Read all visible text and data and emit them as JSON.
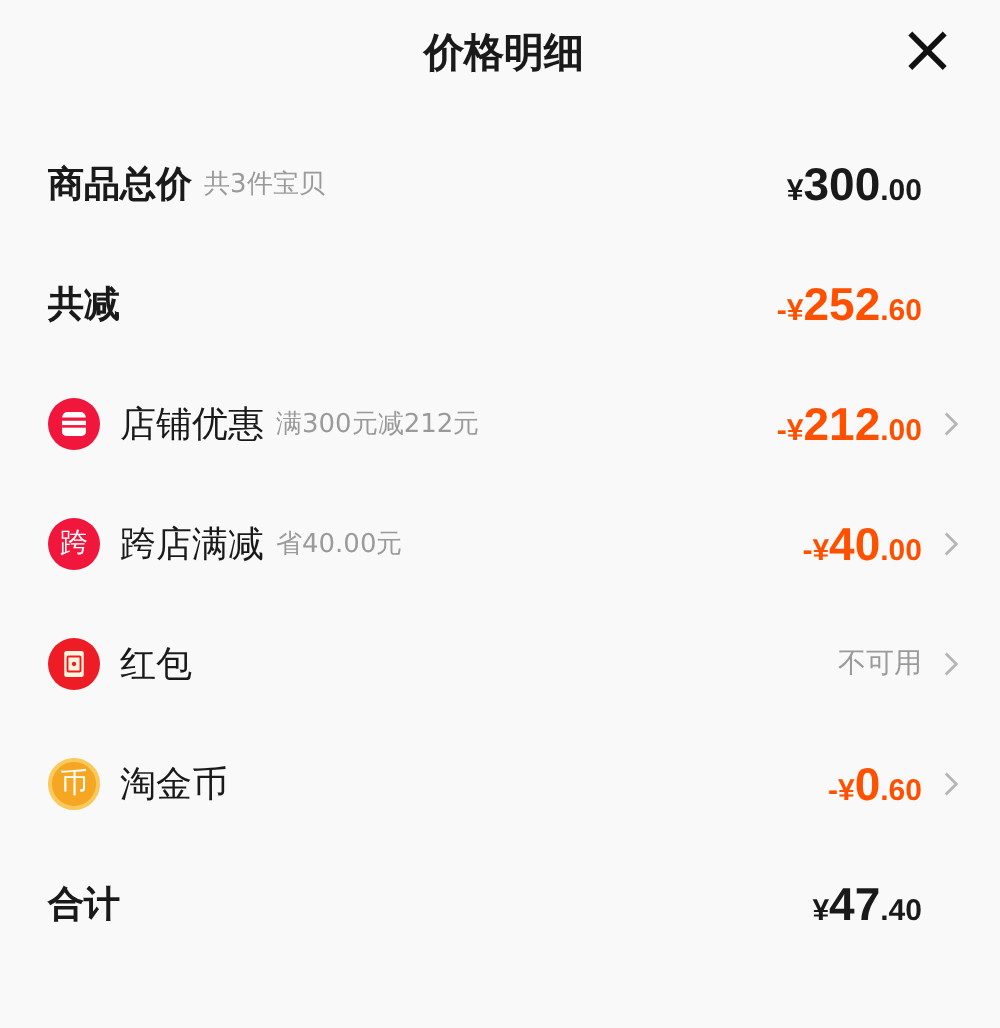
{
  "title": "价格明细",
  "close": "×",
  "rows": [
    {
      "kind": "total",
      "label": "商品总价",
      "note": "共3件宝贝",
      "value": "¥300.00",
      "highlight": false,
      "chevron": false
    },
    {
      "kind": "total",
      "label": "共减",
      "value": "-¥252.60",
      "highlight": true,
      "chevron": false
    },
    {
      "kind": "shop",
      "label": "店铺优惠",
      "note": "满300元减212元",
      "value": "-¥212.00",
      "highlight": true,
      "chevron": true
    },
    {
      "kind": "cross",
      "badge": "跨",
      "label": "跨店满减",
      "note": "省40.00元",
      "value": "-¥40.00",
      "highlight": true,
      "chevron": true
    },
    {
      "kind": "packet",
      "label": "红包",
      "value": "不可用",
      "highlight": false,
      "chevron": true
    },
    {
      "kind": "coin",
      "badge": "币",
      "label": "淘金币",
      "value": "-¥0.60",
      "highlight": true,
      "chevron": true
    },
    {
      "kind": "total",
      "label": "合计",
      "value": "¥47.40",
      "highlight": false,
      "chevron": false
    }
  ]
}
